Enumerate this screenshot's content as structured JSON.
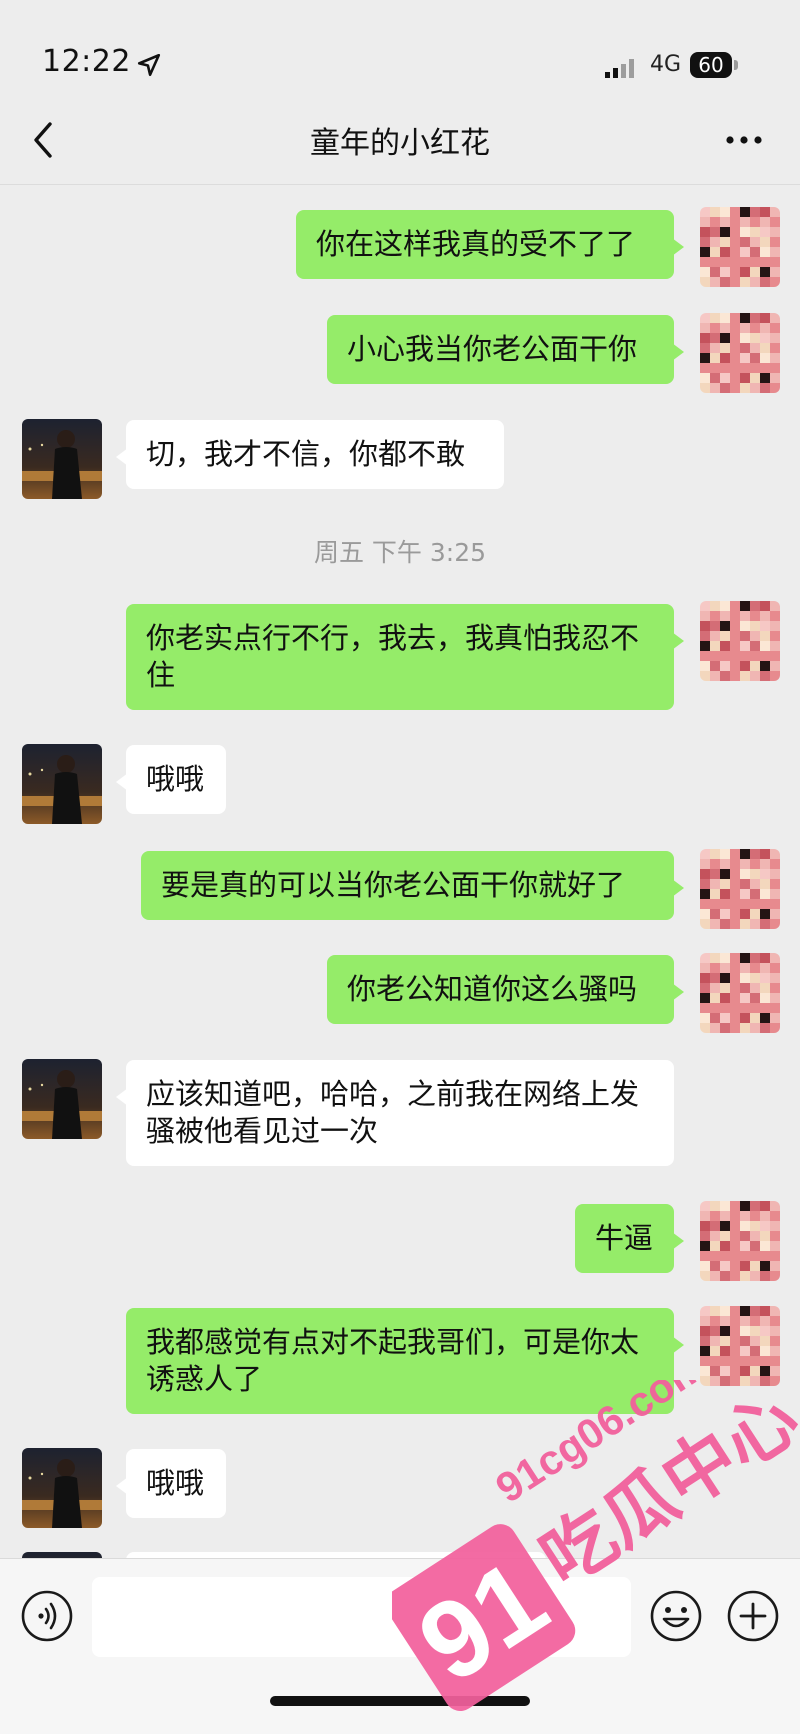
{
  "status_bar": {
    "time": "12:22",
    "network": "4G",
    "battery": "60"
  },
  "nav": {
    "title": "童年的小红花"
  },
  "messages": [
    {
      "side": "right",
      "text": "你在这样我真的受不了了"
    },
    {
      "side": "right",
      "text": "小心我当你老公面干你"
    },
    {
      "side": "left",
      "text": "切，我才不信，你都不敢"
    },
    {
      "side": "right",
      "text": "你老实点行不行，我去，我真怕我忍不住"
    },
    {
      "side": "left",
      "text": "哦哦"
    },
    {
      "side": "right",
      "text": "要是真的可以当你老公面干你就好了"
    },
    {
      "side": "right",
      "text": "你老公知道你这么骚吗"
    },
    {
      "side": "left",
      "text": "应该知道吧，哈哈，之前我在网络上发骚被他看见过一次"
    },
    {
      "side": "right",
      "text": "牛逼"
    },
    {
      "side": "right",
      "text": "我都感觉有点对不起我哥们，可是你太诱惑人了"
    },
    {
      "side": "left",
      "text": "哦哦"
    }
  ],
  "timestamp": "周五 下午 3:25",
  "input": {
    "value": ""
  },
  "watermark": {
    "number": "91",
    "site": "91cg06.com",
    "name": "吃瓜中心"
  },
  "colors": {
    "me_bubble": "#95ec69",
    "other_bubble": "#ffffff",
    "background": "#ededed",
    "watermark": "#f2609c"
  },
  "icons": [
    "location-arrow-icon",
    "signal-icon",
    "back-chevron-icon",
    "more-dots-icon",
    "voice-icon",
    "emoji-icon",
    "plus-icon"
  ]
}
